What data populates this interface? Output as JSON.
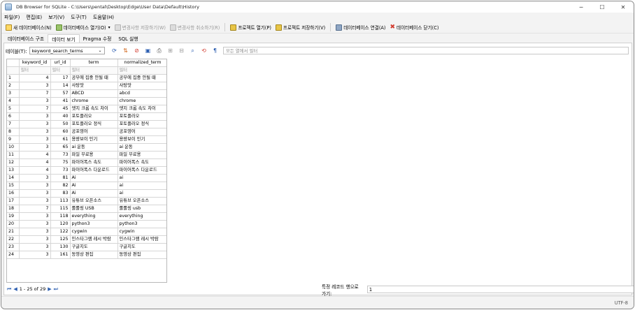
{
  "window": {
    "title": "DB Browser for SQLite - C:\\Users\\pental\\Desktop\\Edge\\User Data\\Default\\History",
    "minimize": "─",
    "maximize": "☐",
    "close": "✕"
  },
  "menu": [
    "파일(F)",
    "편집(E)",
    "보기(V)",
    "도구(T)",
    "도움말(H)"
  ],
  "toolbar": {
    "new_db": "새 데이터베이스(N)",
    "open_db": "데이터베이스 열기(O)",
    "write_changes": "변경사항 저장하기(W)",
    "revert_changes": "변경사항 취소하기(R)",
    "open_project": "프로젝트 열기(P)",
    "save_project": "프로젝트 저장하기(V)",
    "attach_db": "데이터베이스 연결(A)",
    "close_db": "데이터베이스 닫기(C)"
  },
  "tabs": [
    "데이터베이스 구조",
    "데이터 보기",
    "Pragma 수정",
    "SQL 실행"
  ],
  "active_tab": "데이터 보기",
  "browse": {
    "table_label": "테이블(T):",
    "table_value": "keyword_search_terms",
    "filter_placeholder": "모든 열에서 필터"
  },
  "grid": {
    "columns": [
      "keyword_id",
      "url_id",
      "term",
      "normalized_term"
    ],
    "filters": [
      "필터",
      "필터",
      "필터",
      "필터"
    ],
    "rows": [
      [
        "1",
        "4",
        "17",
        "공부에 집중 안될 때",
        "공부에 집중 안될 때"
      ],
      [
        "2",
        "3",
        "14",
        "사탕맛",
        "사탕맛"
      ],
      [
        "3",
        "7",
        "57",
        "ABCD",
        "abcd"
      ],
      [
        "4",
        "3",
        "41",
        "chrome",
        "chrome"
      ],
      [
        "5",
        "7",
        "45",
        "엣지 크롬 속도 차이",
        "엣지 크롬 속도 차이"
      ],
      [
        "6",
        "3",
        "40",
        "포토플러오",
        "포토플러오"
      ],
      [
        "7",
        "3",
        "50",
        "포토플러오 정식",
        "포토플러오 정식"
      ],
      [
        "8",
        "3",
        "60",
        "공포영어",
        "공포영어"
      ],
      [
        "9",
        "3",
        "61",
        "용량보이 인기",
        "용량보이 인기"
      ],
      [
        "10",
        "3",
        "65",
        "ai 운동",
        "ai 운동"
      ],
      [
        "11",
        "4",
        "73",
        "파일 무료용",
        "파일 무료용"
      ],
      [
        "12",
        "4",
        "75",
        "파이어폭스 속도",
        "파이어폭스 속도"
      ],
      [
        "13",
        "4",
        "73",
        "파이어폭스 다운로드",
        "파이어폭스 다운로드"
      ],
      [
        "14",
        "3",
        "81",
        "Ai",
        "ai"
      ],
      [
        "15",
        "3",
        "82",
        "Ai",
        "ai"
      ],
      [
        "16",
        "3",
        "83",
        "Ai",
        "ai"
      ],
      [
        "17",
        "3",
        "113",
        "유튜브 오픈소스",
        "유튜브 오픈소스"
      ],
      [
        "18",
        "7",
        "115",
        "롤롤링 USB",
        "롤롤링 usb"
      ],
      [
        "19",
        "3",
        "118",
        "everything",
        "everything"
      ],
      [
        "20",
        "3",
        "120",
        "python3",
        "python3"
      ],
      [
        "21",
        "3",
        "122",
        "cygwin",
        "cygwin"
      ],
      [
        "22",
        "3",
        "125",
        "인스타그램 레시 박람",
        "인스타그램 레시 박람"
      ],
      [
        "23",
        "3",
        "130",
        "구글지도",
        "구글지도"
      ],
      [
        "24",
        "3",
        "161",
        "동영상 편집",
        "동영상 편집"
      ]
    ]
  },
  "navigation": {
    "range": "1 - 25 of 29",
    "goto_label": "특정 레코드 행으로 가기:",
    "goto_value": "1"
  },
  "status": {
    "encoding": "UTF-8"
  },
  "colors": {
    "green": "#3f9c35",
    "red": "#d23b2f",
    "blue": "#2a5db0",
    "yellow": "#e0b22a"
  }
}
